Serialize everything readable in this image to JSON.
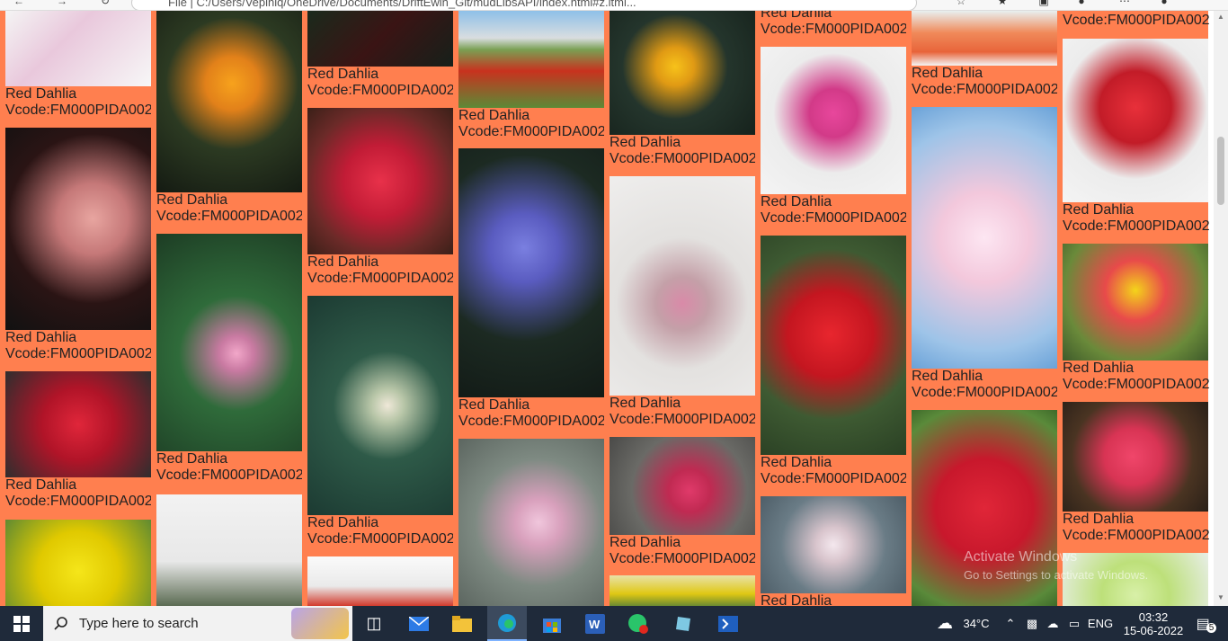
{
  "browser": {
    "url": "File  |  C:/Users/Vepiniq/OneDrive/Documents/DriftEwin_Git/mudLibsAPI/index.html#z.ltml..."
  },
  "gallery": {
    "caption_name": "Red Dahlia",
    "caption_code": "Vcode:FM000PIDA002"
  },
  "colors": {
    "card_bg": "#ff7f4f",
    "taskbar_bg": "#1f2a3a"
  },
  "watermark": {
    "title": "Activate Windows",
    "subtitle": "Go to Settings to activate Windows."
  },
  "taskbar": {
    "search_placeholder": "Type here to search",
    "weather": "34°C",
    "language": "ENG",
    "time": "03:32",
    "date": "15-06-2022",
    "notification_count": "5"
  }
}
